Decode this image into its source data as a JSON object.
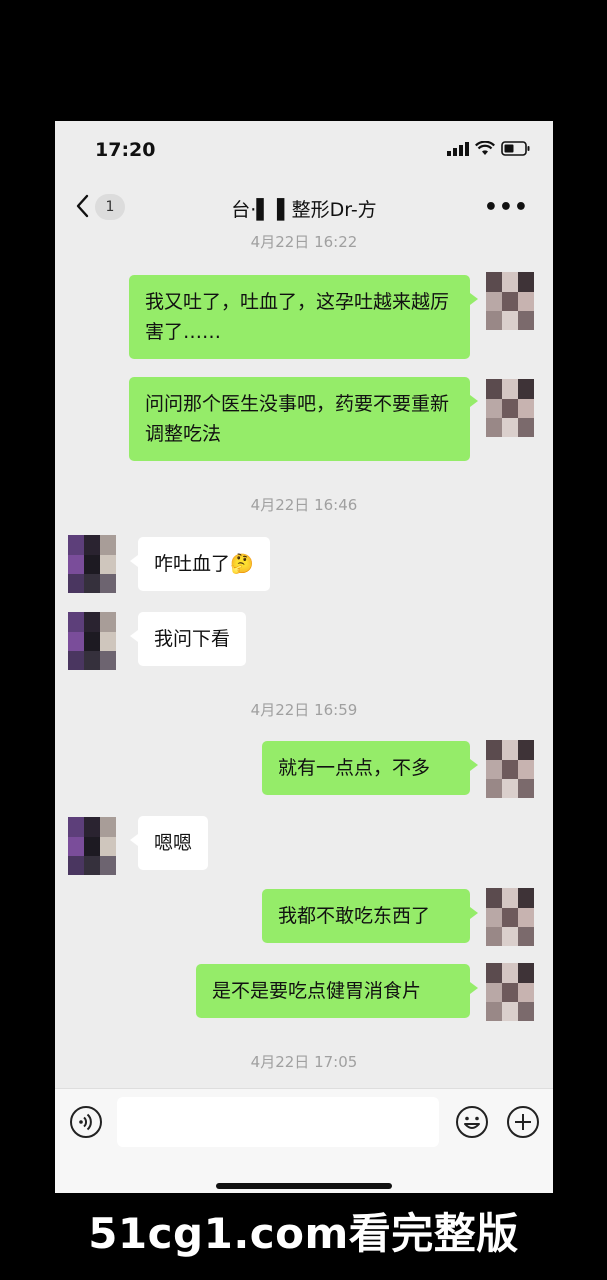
{
  "status_bar": {
    "time": "17:20"
  },
  "nav": {
    "unread_count": "1",
    "title": "台·▌ ▌整形Dr-方"
  },
  "messages": [
    {
      "type": "timestamp",
      "text": "4月22日 16:22"
    },
    {
      "type": "sent",
      "text": "我又吐了，吐血了，这孕吐越来越厉害了……"
    },
    {
      "type": "sent",
      "text": "问问那个医生没事吧，药要不要重新调整吃法"
    },
    {
      "type": "timestamp",
      "text": "4月22日 16:46"
    },
    {
      "type": "received",
      "text": "咋吐血了",
      "emoji": "🤔"
    },
    {
      "type": "received",
      "text": "我问下看"
    },
    {
      "type": "timestamp",
      "text": "4月22日 16:59"
    },
    {
      "type": "sent",
      "text": "就有一点点，不多"
    },
    {
      "type": "received",
      "text": "嗯嗯"
    },
    {
      "type": "sent",
      "text": "我都不敢吃东西了"
    },
    {
      "type": "sent",
      "text": "是不是要吃点健胃消食片"
    },
    {
      "type": "timestamp",
      "text": "4月22日 17:05"
    }
  ],
  "input": {
    "value": "",
    "placeholder": ""
  },
  "icons": {
    "back": "chevron-left-icon",
    "more": "more-dots-icon",
    "voice": "voice-icon",
    "emoji": "emoji-icon",
    "plus": "plus-icon"
  },
  "colors": {
    "sent_bubble": "#95ec69",
    "received_bubble": "#ffffff",
    "background": "#ededed"
  },
  "watermark": "51cg1.com看完整版"
}
